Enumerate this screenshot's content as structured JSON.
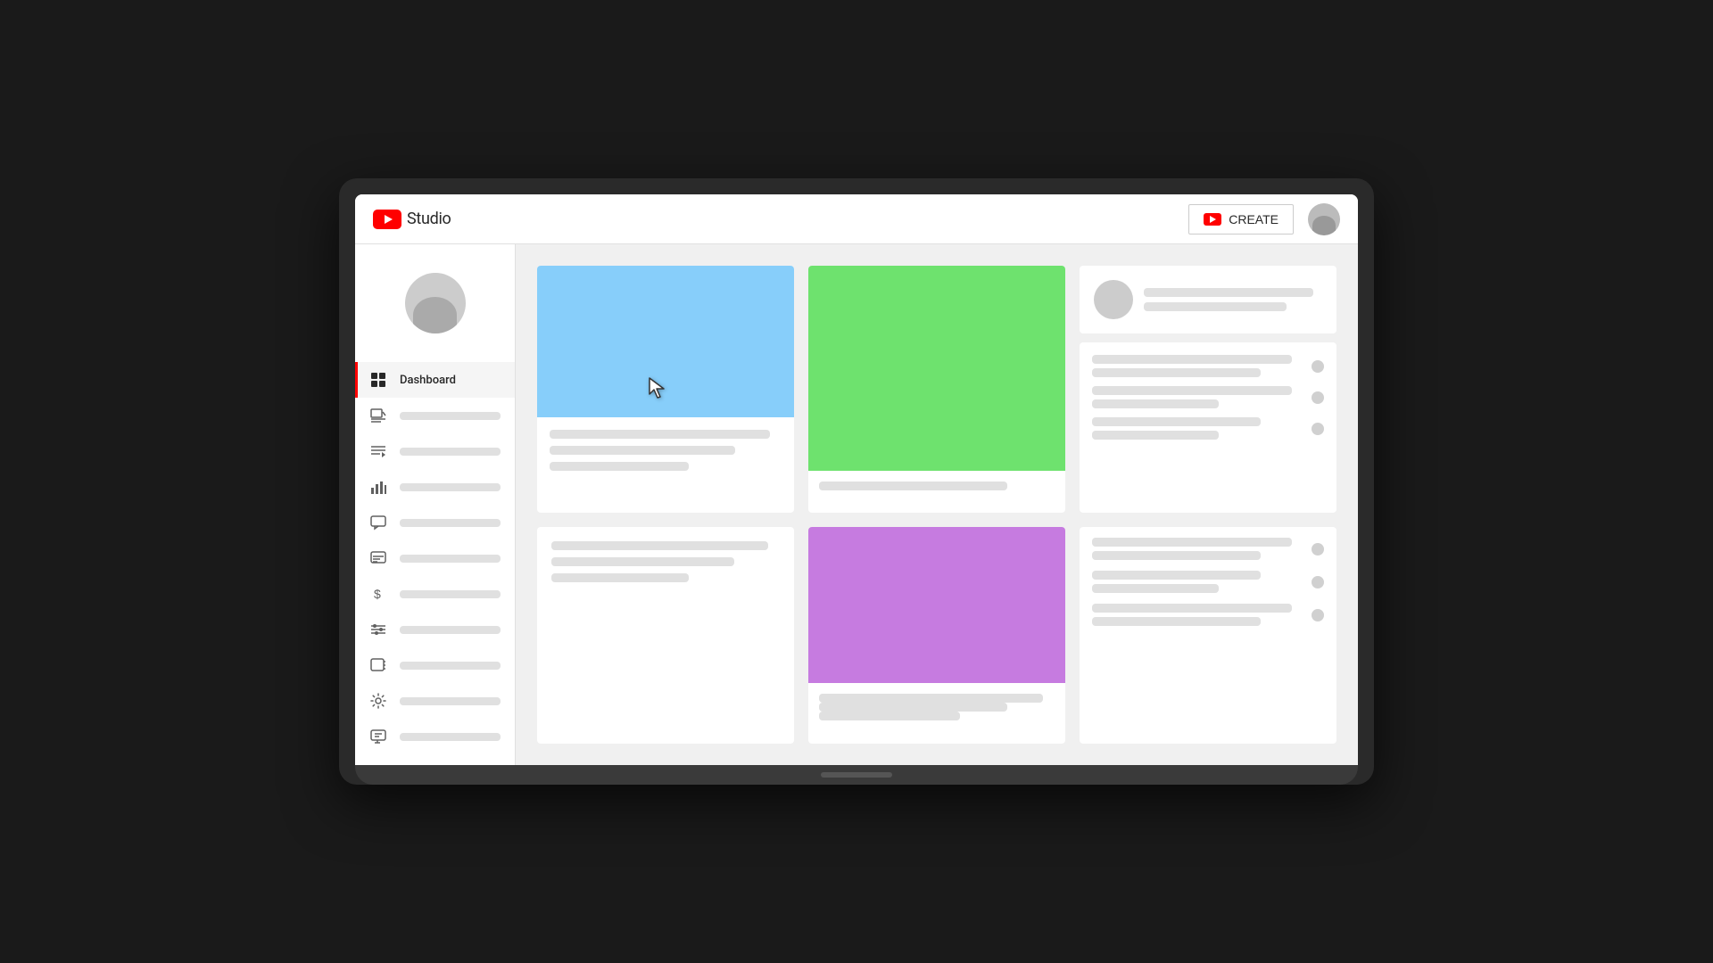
{
  "header": {
    "logo_text": "Studio",
    "create_label": "CREATE"
  },
  "sidebar": {
    "nav_items": [
      {
        "id": "dashboard",
        "label": "Dashboard",
        "active": true
      },
      {
        "id": "content",
        "label": "Content",
        "active": false
      },
      {
        "id": "playlists",
        "label": "Playlists",
        "active": false
      },
      {
        "id": "analytics",
        "label": "Analytics",
        "active": false
      },
      {
        "id": "comments",
        "label": "Comments",
        "active": false
      },
      {
        "id": "subtitles",
        "label": "Subtitles",
        "active": false
      },
      {
        "id": "monetization",
        "label": "Earn",
        "active": false
      },
      {
        "id": "customization",
        "label": "Customization",
        "active": false
      },
      {
        "id": "audio-library",
        "label": "Audio Library",
        "active": false
      }
    ],
    "bottom_items": [
      {
        "id": "settings",
        "label": "Settings"
      },
      {
        "id": "feedback",
        "label": "Send Feedback"
      }
    ]
  },
  "cards": {
    "card1": {
      "image_color": "#87CEFA",
      "image_alt": "Blue thumbnail"
    },
    "card2": {
      "image_color": "#6EE26E",
      "image_alt": "Green thumbnail"
    },
    "card5": {
      "image_color": "#C67BE0",
      "image_alt": "Purple thumbnail"
    }
  },
  "colors": {
    "accent": "#FF0000",
    "active_indicator": "#FF0000"
  }
}
